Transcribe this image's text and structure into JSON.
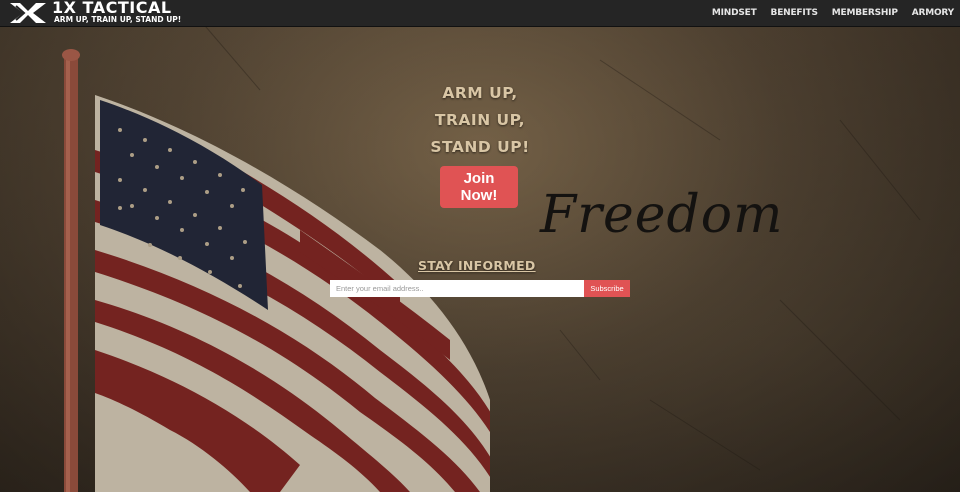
{
  "brand": {
    "title": "1X TACTICAL",
    "tagline": "ARM UP, TRAIN UP, STAND UP!",
    "logo_icon": "x-logo-icon"
  },
  "nav": {
    "items": [
      {
        "label": "MINDSET"
      },
      {
        "label": "BENEFITS"
      },
      {
        "label": "MEMBERSHIP"
      },
      {
        "label": "ARMORY"
      }
    ]
  },
  "hero": {
    "headline": [
      "ARM UP,",
      "TRAIN UP,",
      "STAND UP!"
    ],
    "cta_label": "Join Now!",
    "script_word": "Freedom"
  },
  "newsletter": {
    "heading": "STAY INFORMED",
    "email_placeholder": "Enter your email address..",
    "subscribe_label": "Subscribe"
  },
  "colors": {
    "accent": "#e05354",
    "headline": "#d9c6a5",
    "topbar": "#252525"
  }
}
